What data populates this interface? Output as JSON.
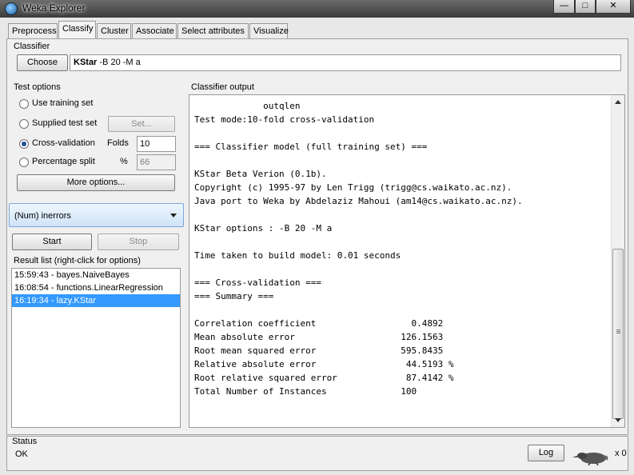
{
  "window": {
    "title": "Weka Explorer",
    "minimize": "—",
    "maximize": "□",
    "close": "✕"
  },
  "tabs": [
    {
      "label": "Preprocess"
    },
    {
      "label": "Classify"
    },
    {
      "label": "Cluster"
    },
    {
      "label": "Associate"
    },
    {
      "label": "Select attributes"
    },
    {
      "label": "Visualize"
    }
  ],
  "classifier": {
    "section_label": "Classifier",
    "choose_label": "Choose",
    "name": "KStar",
    "options": " -B 20 -M a"
  },
  "test_options": {
    "section_label": "Test options",
    "use_training_set": "Use training set",
    "supplied_test_set": "Supplied test set",
    "set_button": "Set...",
    "cross_validation": "Cross-validation",
    "folds_label": "Folds",
    "folds_value": "10",
    "percentage_split": "Percentage split",
    "percent_symbol": "%",
    "percent_value": "66",
    "selected": "cross_validation",
    "more_options": "More options..."
  },
  "class_attribute": {
    "value": "(Num) inerrors"
  },
  "run": {
    "start_label": "Start",
    "stop_label": "Stop"
  },
  "result_list": {
    "label": "Result list (right-click for options)",
    "items": [
      {
        "text": "15:59:43 - bayes.NaiveBayes"
      },
      {
        "text": "16:08:54 - functions.LinearRegression"
      },
      {
        "text": "16:19:34 - lazy.KStar"
      }
    ],
    "selected_index": 2
  },
  "output": {
    "label": "Classifier output",
    "text": "             outqlen\nTest mode:10-fold cross-validation\n\n=== Classifier model (full training set) ===\n\nKStar Beta Verion (0.1b).\nCopyright (c) 1995-97 by Len Trigg (trigg@cs.waikato.ac.nz).\nJava port to Weka by Abdelaziz Mahoui (am14@cs.waikato.ac.nz).\n\nKStar options : -B 20 -M a\n\nTime taken to build model: 0.01 seconds\n\n=== Cross-validation ===\n=== Summary ===\n\nCorrelation coefficient                  0.4892\nMean absolute error                    126.1563\nRoot mean squared error                595.8435\nRelative absolute error                 44.5193 %\nRoot relative squared error             87.4142 %\nTotal Number of Instances              100     "
  },
  "status": {
    "label": "Status",
    "text": "OK",
    "log_label": "Log",
    "task_count": "x 0"
  },
  "colors": {
    "selection": "#3399ff",
    "combo_border": "#7aa7d8"
  }
}
